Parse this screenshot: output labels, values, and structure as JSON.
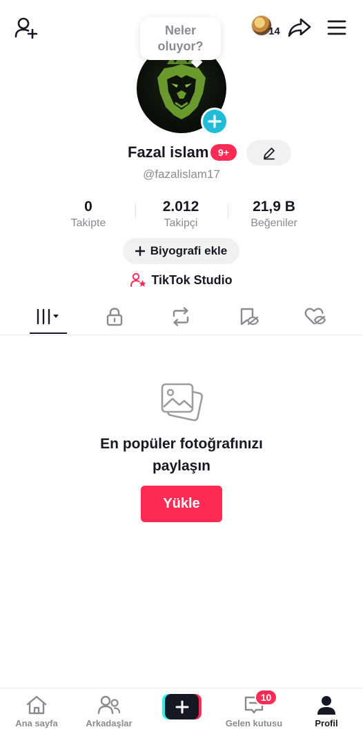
{
  "header": {
    "add_friend_icon": "add-user-icon",
    "share_icon": "share-arrow-icon",
    "menu_icon": "hamburger-menu-icon",
    "profile_views_count": "14"
  },
  "tooltip": {
    "line1": "Neler",
    "line2": "oluyor?"
  },
  "profile": {
    "name": "Fazal islam",
    "notification_badge": "9+",
    "handle": "@fazalislam17"
  },
  "stats": [
    {
      "value": "0",
      "label": "Takipte"
    },
    {
      "value": "2.012",
      "label": "Takipçi"
    },
    {
      "value": "21,9 B",
      "label": "Beğeniler"
    }
  ],
  "bio_button": {
    "label": "Biyografi ekle",
    "icon": "plus-icon"
  },
  "studio_link": {
    "label": "TikTok Studio",
    "icon": "user-star-icon"
  },
  "tabs": [
    {
      "name": "videos-grid",
      "icon": "grid-bars-icon",
      "active": true
    },
    {
      "name": "private",
      "icon": "lock-icon",
      "active": false
    },
    {
      "name": "reposts",
      "icon": "repost-icon",
      "active": false
    },
    {
      "name": "favorites",
      "icon": "bookmark-hidden-icon",
      "active": false
    },
    {
      "name": "liked",
      "icon": "heart-hidden-icon",
      "active": false
    }
  ],
  "empty_state": {
    "icon": "photo-stack-icon",
    "title_line1": "En popüler fotoğrafınızı",
    "title_line2": "paylaşın",
    "button_label": "Yükle"
  },
  "bottom_nav": {
    "items": [
      {
        "label": "Ana sayfa",
        "icon": "home-icon"
      },
      {
        "label": "Arkadaşlar",
        "icon": "friends-icon"
      },
      {
        "label": "",
        "icon": "plus-icon"
      },
      {
        "label": "Gelen kutusu",
        "icon": "inbox-icon"
      },
      {
        "label": "Profil",
        "icon": "profile-icon"
      }
    ],
    "inbox_badge": "10"
  },
  "colors": {
    "brand_red": "#fe2c55",
    "brand_cyan": "#25f4ee",
    "text_primary": "#161823",
    "text_secondary": "#8a8b91",
    "plus_badge": "#20bcd8"
  }
}
